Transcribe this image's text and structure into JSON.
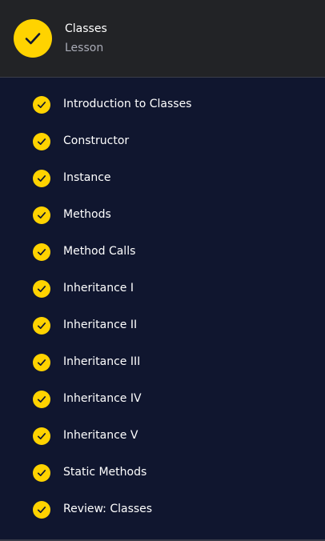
{
  "header": {
    "title": "Classes",
    "subtitle": "Lesson",
    "icon": "check-icon"
  },
  "colors": {
    "background": "#10162f",
    "header_background": "#222326",
    "accent": "#ffd300",
    "text": "#ffffff",
    "muted_text": "#a9abb6"
  },
  "items": [
    {
      "label": "Introduction to Classes",
      "completed": true
    },
    {
      "label": "Constructor",
      "completed": true
    },
    {
      "label": "Instance",
      "completed": true
    },
    {
      "label": "Methods",
      "completed": true
    },
    {
      "label": "Method Calls",
      "completed": true
    },
    {
      "label": "Inheritance I",
      "completed": true
    },
    {
      "label": "Inheritance II",
      "completed": true
    },
    {
      "label": "Inheritance III",
      "completed": true
    },
    {
      "label": "Inheritance IV",
      "completed": true
    },
    {
      "label": "Inheritance V",
      "completed": true
    },
    {
      "label": "Static Methods",
      "completed": true
    },
    {
      "label": "Review: Classes",
      "completed": true
    }
  ]
}
